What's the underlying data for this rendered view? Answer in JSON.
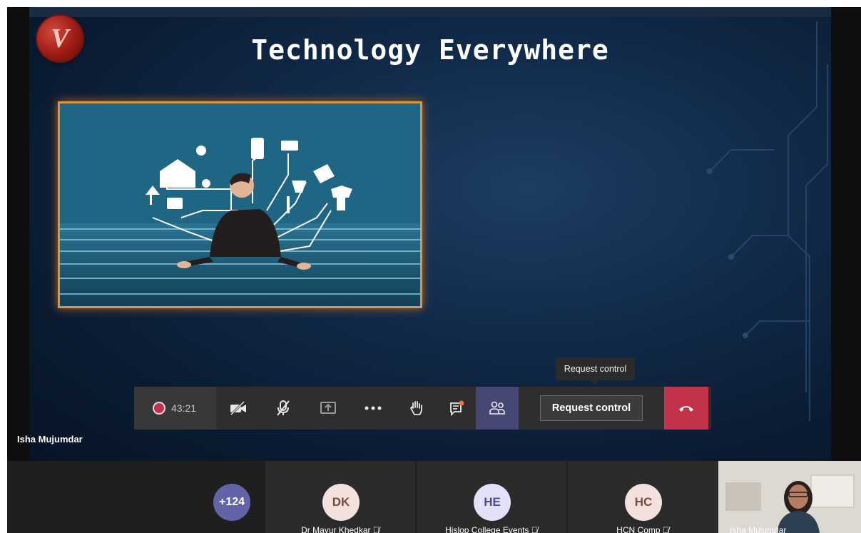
{
  "slide": {
    "title": "Technology Everywhere",
    "logo_letter": "V"
  },
  "meeting": {
    "timer": "43:21",
    "request_control_label": "Request control",
    "tooltip": "Request control",
    "speaker_name": "Isha Mujumdar",
    "leave_color": "#c4314b",
    "accent": "#6264a7"
  },
  "toolbar_icons": [
    "record-icon",
    "camera-off-icon",
    "mic-off-icon",
    "share-screen-icon",
    "more-icon",
    "raise-hand-icon",
    "chat-icon",
    "participants-icon",
    "hang-up-icon"
  ],
  "participants": {
    "overflow_count": "+124",
    "tiles": [
      {
        "initials": "DK",
        "name": "Dr Mayur Khedkar",
        "avatar_bg": "#f2e1dc",
        "avatar_fg": "#7a4b3f"
      },
      {
        "initials": "HE",
        "name": "Hislop College Events",
        "avatar_bg": "#e2e1f7",
        "avatar_fg": "#4b4a9c"
      },
      {
        "initials": "HC",
        "name": "HCN Comp",
        "avatar_bg": "#f2e1dc",
        "avatar_fg": "#7a4b3f"
      }
    ],
    "self_name": "Isha Mujumdar"
  }
}
